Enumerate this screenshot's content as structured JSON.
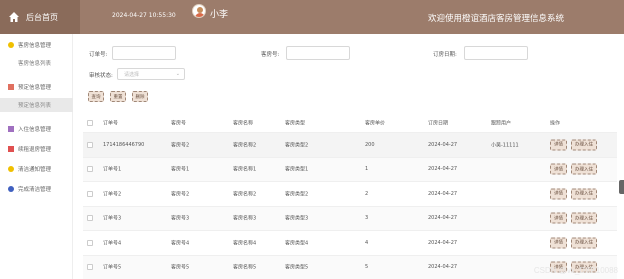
{
  "header": {
    "home_label": "后台首页",
    "datetime": "2024-04-27 10:55:30",
    "username": "小李",
    "system_title": "欢迎使用橙谊酒店客房管理信息系统"
  },
  "sidebar": {
    "items": [
      {
        "label": "客房信息管理",
        "icon": "circle-icon",
        "color": "#f0c000"
      },
      {
        "label": "客房信息列表",
        "sub": true
      },
      {
        "label": "预定信息管理",
        "icon": "grid-icon",
        "color": "#e07060"
      },
      {
        "label": "预定信息列表",
        "sub": true,
        "active": true
      },
      {
        "label": "入住信息管理",
        "icon": "grid-icon",
        "color": "#a070c0"
      },
      {
        "label": "续租退房管理",
        "icon": "grid-icon",
        "color": "#e05050"
      },
      {
        "label": "清洁通知管理",
        "icon": "circle-icon",
        "color": "#f0c000"
      },
      {
        "label": "完成清洁管理",
        "icon": "circle-icon",
        "color": "#4060c0"
      }
    ]
  },
  "filters": {
    "order_no_label": "订单号:",
    "room_no_label": "客房号:",
    "order_date_label": "订房日期:",
    "audit_status_label": "审核状态:",
    "audit_status_placeholder": "请选择"
  },
  "buttons": {
    "search": "查询",
    "reset": "重置",
    "delete": "删除"
  },
  "table": {
    "headers": [
      "订单号",
      "客房号",
      "客房名称",
      "客房类型",
      "客房单价",
      "订房日期",
      "跟踪用户",
      "操作"
    ],
    "rows": [
      {
        "order": "1714186446790",
        "room": "客房号2",
        "name": "客房名称2",
        "type": "客房类型2",
        "price": "200",
        "date": "2024-04-27",
        "user": "小吴-11111"
      },
      {
        "order": "订单号1",
        "room": "客房号1",
        "name": "客房名称1",
        "type": "客房类型1",
        "price": "1",
        "date": "2024-04-27",
        "user": ""
      },
      {
        "order": "订单号2",
        "room": "客房号2",
        "name": "客房名称2",
        "type": "客房类型2",
        "price": "2",
        "date": "2024-04-27",
        "user": ""
      },
      {
        "order": "订单号3",
        "room": "客房号3",
        "name": "客房名称3",
        "type": "客房类型3",
        "price": "3",
        "date": "2024-04-27",
        "user": ""
      },
      {
        "order": "订单号4",
        "room": "客房号4",
        "name": "客房名称4",
        "type": "客房类型4",
        "price": "4",
        "date": "2024-04-27",
        "user": ""
      },
      {
        "order": "订单号5",
        "room": "客房号5",
        "name": "客房名称5",
        "type": "客房类型5",
        "price": "5",
        "date": "2024-04-27",
        "user": ""
      }
    ],
    "action_detail": "详情",
    "action_checkin": "办理入住"
  },
  "watermark": "CSDN @vx_DXP10088"
}
